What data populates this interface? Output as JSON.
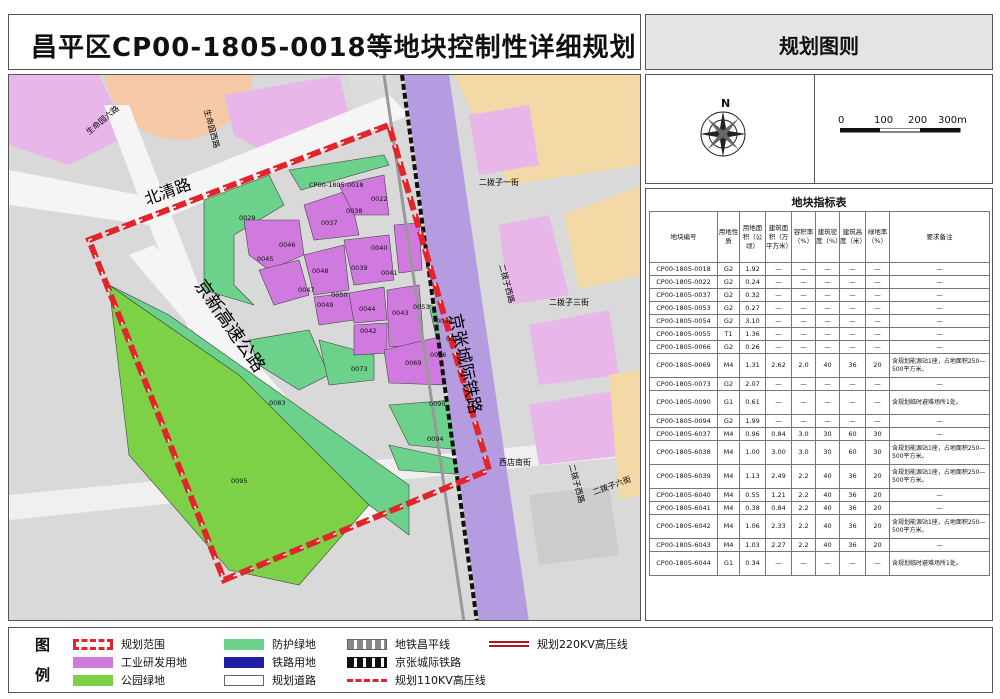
{
  "title": "昌平区CP00-1805-0018等地块控制性详细规划",
  "side_header": "规划图则",
  "compass": {
    "north": "N",
    "scale_labels": [
      "0",
      "100",
      "200",
      "300m"
    ]
  },
  "map": {
    "roads": {
      "beiqing": "北清路",
      "jingxin": "京新高速公路",
      "jingzhang": "京张城际铁路",
      "shengming_east": "生命园东路",
      "shengming_six": "生命园六路",
      "shengming_road": "生命园西路",
      "xidian_south": "西店南街",
      "er_one": "二拨子一街",
      "er_three": "二拨子三街",
      "er_six": "二拨子六街",
      "er_west": "二拨子西路",
      "er_west2": "二拨子西路",
      "xidian_north": "西店北街"
    },
    "plots": [
      "CP00-1805-0018",
      "0022",
      "0029",
      "0037",
      "0038",
      "0039",
      "0040",
      "0041",
      "0042",
      "0043",
      "0044",
      "0045",
      "0046",
      "0047",
      "0048",
      "0049",
      "0050",
      "0053",
      "0054",
      "0055",
      "0066",
      "0069",
      "0073",
      "0083",
      "0090",
      "0094",
      "0095"
    ]
  },
  "table": {
    "caption": "地块指标表",
    "headers": [
      "地块编号",
      "用地性质",
      "用地面积（公顷）",
      "建筑面积（万平方米）",
      "容积率（%）",
      "建筑密度（%）",
      "建筑高度（米）",
      "绿地率（%）",
      "要求备注"
    ],
    "rows": [
      [
        "CP00-1805-0018",
        "G2",
        "1.92",
        "—",
        "—",
        "—",
        "—",
        "—",
        "—"
      ],
      [
        "CP00-1805-0022",
        "G2",
        "0.24",
        "—",
        "—",
        "—",
        "—",
        "—",
        "—"
      ],
      [
        "CP00-1805-0037",
        "G2",
        "0.32",
        "—",
        "—",
        "—",
        "—",
        "—",
        "—"
      ],
      [
        "CP00-1805-0053",
        "G2",
        "0.27",
        "—",
        "—",
        "—",
        "—",
        "—",
        "—"
      ],
      [
        "CP00-1805-0054",
        "G2",
        "3.10",
        "—",
        "—",
        "—",
        "—",
        "—",
        "—"
      ],
      [
        "CP00-1805-0055",
        "T1",
        "1.36",
        "—",
        "—",
        "—",
        "—",
        "—",
        "—"
      ],
      [
        "CP00-1805-0066",
        "G2",
        "0.26",
        "—",
        "—",
        "—",
        "—",
        "—",
        "—"
      ],
      [
        "CP00-1805-0069",
        "M4",
        "1.31",
        "2.62",
        "2.0",
        "40",
        "36",
        "20",
        "含规划能源站1座，占地面积250—500平方米。"
      ],
      [
        "CP00-1805-0073",
        "G2",
        "2.07",
        "—",
        "—",
        "—",
        "—",
        "—",
        "—"
      ],
      [
        "CP00-1805-0090",
        "G1",
        "0.61",
        "—",
        "—",
        "—",
        "—",
        "—",
        "含规划临时避难场所1处。"
      ],
      [
        "CP00-1805-0094",
        "G2",
        "1.99",
        "—",
        "—",
        "—",
        "—",
        "—",
        "—"
      ],
      [
        "CP00-1805-6037",
        "M4",
        "0.96",
        "0.84",
        "3.0",
        "30",
        "60",
        "30",
        "—"
      ],
      [
        "CP00-1805-6038",
        "M4",
        "1.00",
        "3.00",
        "3.0",
        "30",
        "60",
        "30",
        "含规划能源站1座，占地面积250—500平方米。"
      ],
      [
        "CP00-1805-6039",
        "M4",
        "1.13",
        "2.49",
        "2.2",
        "40",
        "36",
        "20",
        "含规划能源站1座，占地面积250—500平方米。"
      ],
      [
        "CP00-1805-6040",
        "M4",
        "0.55",
        "1.21",
        "2.2",
        "40",
        "36",
        "20",
        "—"
      ],
      [
        "CP00-1805-6041",
        "M4",
        "0.38",
        "0.84",
        "2.2",
        "40",
        "36",
        "20",
        "—"
      ],
      [
        "CP00-1805-6042",
        "M4",
        "1.06",
        "2.33",
        "2.2",
        "40",
        "36",
        "20",
        "含规划能源站1座，占地面积250—500平方米。"
      ],
      [
        "CP00-1805-6043",
        "M4",
        "1.03",
        "2.27",
        "2.2",
        "40",
        "36",
        "20",
        "—"
      ],
      [
        "CP00-1805-6044",
        "G1",
        "0.34",
        "—",
        "—",
        "—",
        "—",
        "—",
        "含规划临时避难场所1处。"
      ]
    ]
  },
  "legend": {
    "title1": "图",
    "title2": "例",
    "items": [
      {
        "label": "规划范围",
        "color": "#e0252b"
      },
      {
        "label": "工业研发用地",
        "color": "#d07ae0"
      },
      {
        "label": "公园绿地",
        "color": "#7cd146"
      },
      {
        "label": "防护绿地",
        "color": "#6bd18b"
      },
      {
        "label": "铁路用地",
        "color": "#1f1fa8"
      },
      {
        "label": "规划道路",
        "color": "#ffffff"
      },
      {
        "label": "地铁昌平线",
        "color": "#9a9a9a"
      },
      {
        "label": "京张城际铁路",
        "color": "#111111"
      },
      {
        "label": "规划110KV高压线",
        "color": "#e0252b"
      },
      {
        "label": "规划220KV高压线",
        "color": "#b0161c"
      }
    ]
  }
}
